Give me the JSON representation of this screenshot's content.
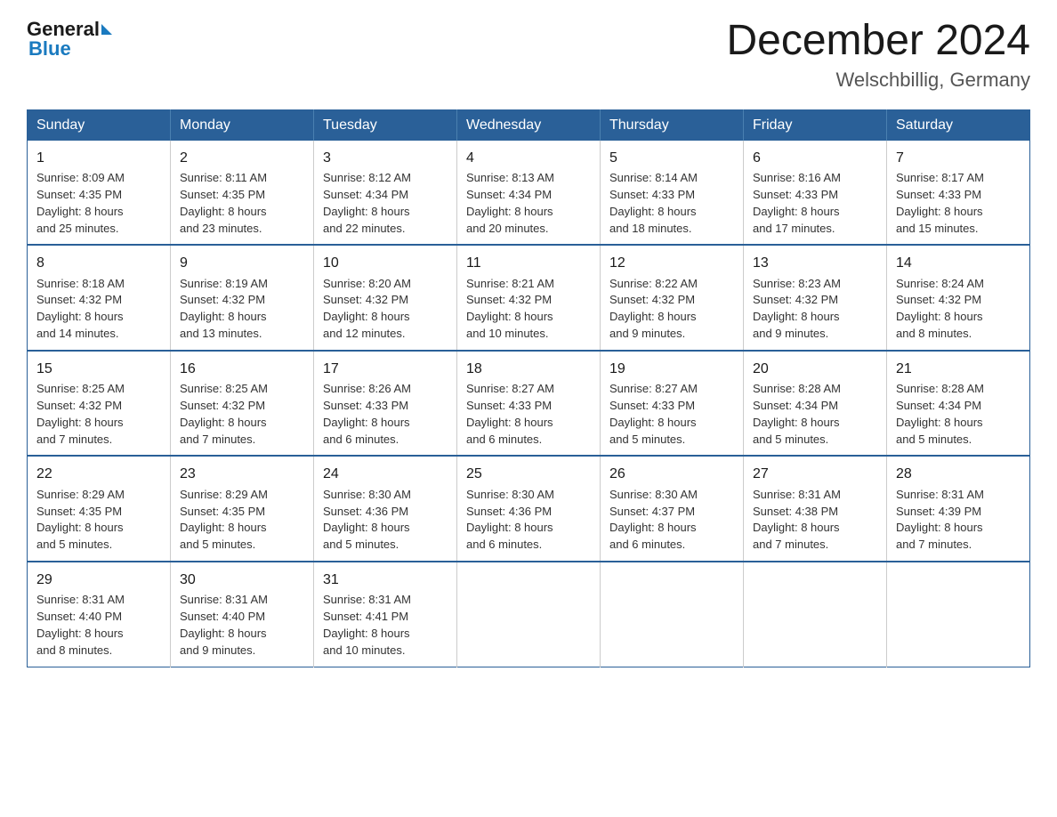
{
  "header": {
    "logo_general": "General",
    "logo_blue": "Blue",
    "title": "December 2024",
    "subtitle": "Welschbillig, Germany"
  },
  "days_of_week": [
    "Sunday",
    "Monday",
    "Tuesday",
    "Wednesday",
    "Thursday",
    "Friday",
    "Saturday"
  ],
  "weeks": [
    [
      {
        "day": "1",
        "sunrise": "8:09 AM",
        "sunset": "4:35 PM",
        "daylight_hours": "8 hours",
        "daylight_minutes": "and 25 minutes."
      },
      {
        "day": "2",
        "sunrise": "8:11 AM",
        "sunset": "4:35 PM",
        "daylight_hours": "8 hours",
        "daylight_minutes": "and 23 minutes."
      },
      {
        "day": "3",
        "sunrise": "8:12 AM",
        "sunset": "4:34 PM",
        "daylight_hours": "8 hours",
        "daylight_minutes": "and 22 minutes."
      },
      {
        "day": "4",
        "sunrise": "8:13 AM",
        "sunset": "4:34 PM",
        "daylight_hours": "8 hours",
        "daylight_minutes": "and 20 minutes."
      },
      {
        "day": "5",
        "sunrise": "8:14 AM",
        "sunset": "4:33 PM",
        "daylight_hours": "8 hours",
        "daylight_minutes": "and 18 minutes."
      },
      {
        "day": "6",
        "sunrise": "8:16 AM",
        "sunset": "4:33 PM",
        "daylight_hours": "8 hours",
        "daylight_minutes": "and 17 minutes."
      },
      {
        "day": "7",
        "sunrise": "8:17 AM",
        "sunset": "4:33 PM",
        "daylight_hours": "8 hours",
        "daylight_minutes": "and 15 minutes."
      }
    ],
    [
      {
        "day": "8",
        "sunrise": "8:18 AM",
        "sunset": "4:32 PM",
        "daylight_hours": "8 hours",
        "daylight_minutes": "and 14 minutes."
      },
      {
        "day": "9",
        "sunrise": "8:19 AM",
        "sunset": "4:32 PM",
        "daylight_hours": "8 hours",
        "daylight_minutes": "and 13 minutes."
      },
      {
        "day": "10",
        "sunrise": "8:20 AM",
        "sunset": "4:32 PM",
        "daylight_hours": "8 hours",
        "daylight_minutes": "and 12 minutes."
      },
      {
        "day": "11",
        "sunrise": "8:21 AM",
        "sunset": "4:32 PM",
        "daylight_hours": "8 hours",
        "daylight_minutes": "and 10 minutes."
      },
      {
        "day": "12",
        "sunrise": "8:22 AM",
        "sunset": "4:32 PM",
        "daylight_hours": "8 hours",
        "daylight_minutes": "and 9 minutes."
      },
      {
        "day": "13",
        "sunrise": "8:23 AM",
        "sunset": "4:32 PM",
        "daylight_hours": "8 hours",
        "daylight_minutes": "and 9 minutes."
      },
      {
        "day": "14",
        "sunrise": "8:24 AM",
        "sunset": "4:32 PM",
        "daylight_hours": "8 hours",
        "daylight_minutes": "and 8 minutes."
      }
    ],
    [
      {
        "day": "15",
        "sunrise": "8:25 AM",
        "sunset": "4:32 PM",
        "daylight_hours": "8 hours",
        "daylight_minutes": "and 7 minutes."
      },
      {
        "day": "16",
        "sunrise": "8:25 AM",
        "sunset": "4:32 PM",
        "daylight_hours": "8 hours",
        "daylight_minutes": "and 7 minutes."
      },
      {
        "day": "17",
        "sunrise": "8:26 AM",
        "sunset": "4:33 PM",
        "daylight_hours": "8 hours",
        "daylight_minutes": "and 6 minutes."
      },
      {
        "day": "18",
        "sunrise": "8:27 AM",
        "sunset": "4:33 PM",
        "daylight_hours": "8 hours",
        "daylight_minutes": "and 6 minutes."
      },
      {
        "day": "19",
        "sunrise": "8:27 AM",
        "sunset": "4:33 PM",
        "daylight_hours": "8 hours",
        "daylight_minutes": "and 5 minutes."
      },
      {
        "day": "20",
        "sunrise": "8:28 AM",
        "sunset": "4:34 PM",
        "daylight_hours": "8 hours",
        "daylight_minutes": "and 5 minutes."
      },
      {
        "day": "21",
        "sunrise": "8:28 AM",
        "sunset": "4:34 PM",
        "daylight_hours": "8 hours",
        "daylight_minutes": "and 5 minutes."
      }
    ],
    [
      {
        "day": "22",
        "sunrise": "8:29 AM",
        "sunset": "4:35 PM",
        "daylight_hours": "8 hours",
        "daylight_minutes": "and 5 minutes."
      },
      {
        "day": "23",
        "sunrise": "8:29 AM",
        "sunset": "4:35 PM",
        "daylight_hours": "8 hours",
        "daylight_minutes": "and 5 minutes."
      },
      {
        "day": "24",
        "sunrise": "8:30 AM",
        "sunset": "4:36 PM",
        "daylight_hours": "8 hours",
        "daylight_minutes": "and 5 minutes."
      },
      {
        "day": "25",
        "sunrise": "8:30 AM",
        "sunset": "4:36 PM",
        "daylight_hours": "8 hours",
        "daylight_minutes": "and 6 minutes."
      },
      {
        "day": "26",
        "sunrise": "8:30 AM",
        "sunset": "4:37 PM",
        "daylight_hours": "8 hours",
        "daylight_minutes": "and 6 minutes."
      },
      {
        "day": "27",
        "sunrise": "8:31 AM",
        "sunset": "4:38 PM",
        "daylight_hours": "8 hours",
        "daylight_minutes": "and 7 minutes."
      },
      {
        "day": "28",
        "sunrise": "8:31 AM",
        "sunset": "4:39 PM",
        "daylight_hours": "8 hours",
        "daylight_minutes": "and 7 minutes."
      }
    ],
    [
      {
        "day": "29",
        "sunrise": "8:31 AM",
        "sunset": "4:40 PM",
        "daylight_hours": "8 hours",
        "daylight_minutes": "and 8 minutes."
      },
      {
        "day": "30",
        "sunrise": "8:31 AM",
        "sunset": "4:40 PM",
        "daylight_hours": "8 hours",
        "daylight_minutes": "and 9 minutes."
      },
      {
        "day": "31",
        "sunrise": "8:31 AM",
        "sunset": "4:41 PM",
        "daylight_hours": "8 hours",
        "daylight_minutes": "and 10 minutes."
      },
      null,
      null,
      null,
      null
    ]
  ],
  "labels": {
    "sunrise": "Sunrise:",
    "sunset": "Sunset:",
    "daylight": "Daylight:"
  }
}
